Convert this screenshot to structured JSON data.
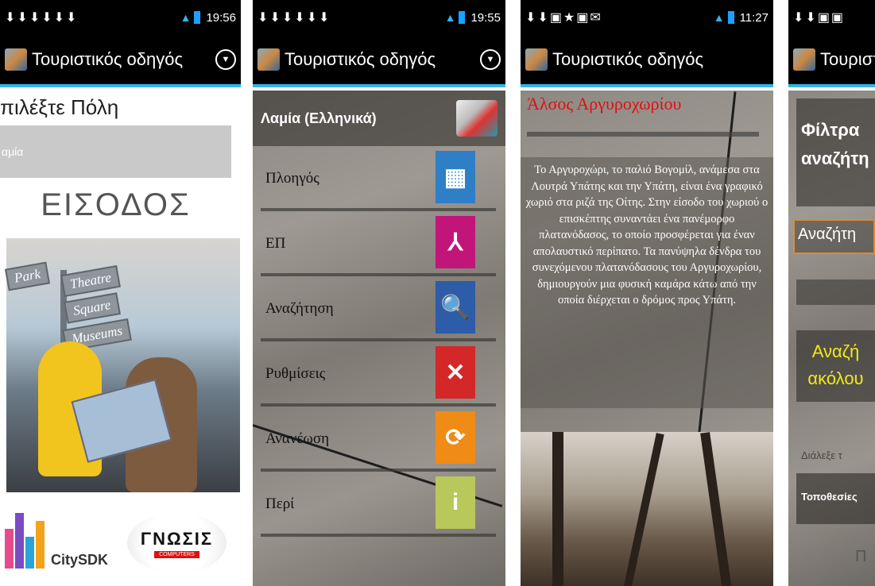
{
  "common": {
    "app_title": "Τουριστικός οδηγός"
  },
  "panel1": {
    "time": "19:56",
    "label": "πιλέξτε Πόλη",
    "city_value": "αμία",
    "enter_button": "ΕΙΣΟΔΟΣ",
    "signs": [
      "Park",
      "Theatre",
      "Square",
      "Museums"
    ],
    "logo_citysdk": "CitySDK",
    "logo_gnosis": "ΓΝΩΣΙΣ",
    "logo_gnosis_sub": "COMPUTERS"
  },
  "panel2": {
    "time": "19:55",
    "header": "Λαμία (Ελληνικά)",
    "menu": [
      {
        "label": "Πλοηγός",
        "icon": "map-icon",
        "glyph": "▦",
        "color": "#2f7fc6"
      },
      {
        "label": "ΕΠ",
        "icon": "xyz-axes-icon",
        "glyph": "⅄",
        "color": "#c2157a"
      },
      {
        "label": "Αναζήτηση",
        "icon": "document-search-icon",
        "glyph": "🔍",
        "color": "#2d5ca8"
      },
      {
        "label": "Ρυθμίσεις",
        "icon": "tools-icon",
        "glyph": "✕",
        "color": "#d42727"
      },
      {
        "label": "Ανανέωση",
        "icon": "refresh-icon",
        "glyph": "⟳",
        "color": "#f08b16"
      },
      {
        "label": "Περί",
        "icon": "info-icon",
        "glyph": "i",
        "color": "#b8c85a"
      }
    ]
  },
  "panel3": {
    "time": "11:27",
    "title": "Άλσος Αργυροχωρίου",
    "description": "Το Αργυροχώρι, το παλιό Βογομίλ, ανάμεσα στα Λουτρά Υπάτης και την Υπάτη, είναι ένα γραφικό χωριό στα ριζά της Οίτης. Στην είσοδο του χωριού ο επισκέπτης συναντάει ένα πανέμορφο πλατανόδασος, το οποίο προσφέρεται για έναν απολαυστικό περίπατο. Τα πανύψηλα δένδρα του συνεχόμενου πλατανόδασους του Αργυροχωρίου, δημιουργούν μια φυσική καμάρα κάτω από την οποία διέρχεται ο δρόμος προς Υπάτη."
  },
  "panel4": {
    "title_partial": "Τουριστ",
    "filter_line1": "Φίλτρα",
    "filter_line2": "αναζήτη",
    "search_partial": "Αναζήτη",
    "yellow_line1": "Αναζή",
    "yellow_line2": "ακόλου",
    "choose_partial": "Διάλεξε τ",
    "locations_partial": "Τοποθεσίες",
    "last_partial": "Π"
  }
}
